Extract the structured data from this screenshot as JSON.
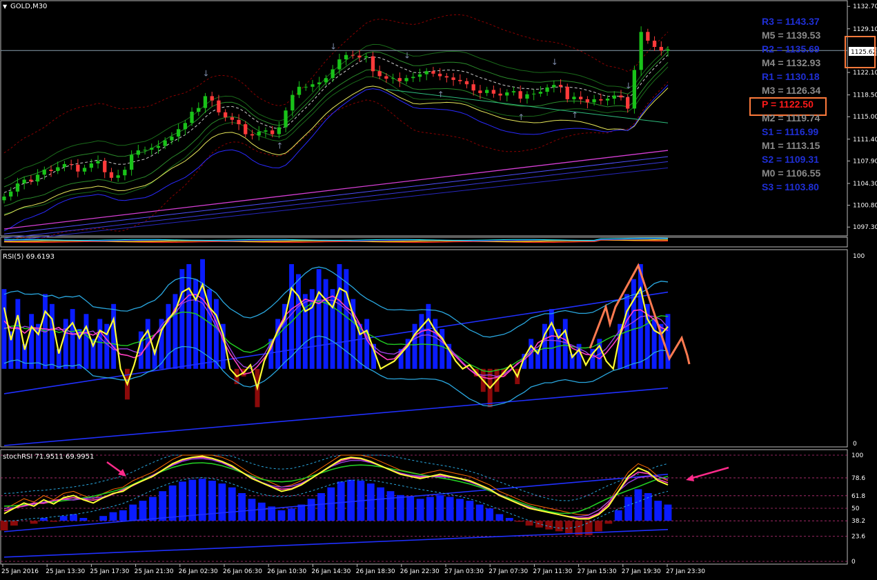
{
  "header": {
    "symbol_label": "GOLD,M30",
    "rsi_label": "RSI(5) 69.6193",
    "stoch_label": "stochRSI 71.9511 69.9951"
  },
  "current_price": "1125.62",
  "colors": {
    "background": "#000000",
    "bull_candle": "#19c219",
    "bear_candle": "#ff3a3a",
    "pivot_blue": "#1f2fd6",
    "pivot_gray": "#8a8a8a",
    "pivot_red": "#ff1a1a",
    "highlight_box": "#ff7a3c",
    "rsi_line": "#ffff33",
    "hist_up": "#0a1cff",
    "hist_down": "#8b0a0a"
  },
  "pivots": [
    {
      "label": "R3 = 1143.37",
      "color": "blue"
    },
    {
      "label": "M5 = 1139.53",
      "color": "gray"
    },
    {
      "label": "R2 = 1135.69",
      "color": "blue"
    },
    {
      "label": "M4 = 1132.93",
      "color": "gray"
    },
    {
      "label": "R1 = 1130.18",
      "color": "blue"
    },
    {
      "label": "M3 = 1126.34",
      "color": "gray"
    },
    {
      "label": "P  = 1122.50",
      "color": "red"
    },
    {
      "label": "M2 = 1119.74",
      "color": "gray"
    },
    {
      "label": "S1 = 1116.99",
      "color": "blue"
    },
    {
      "label": "M1 = 1113.15",
      "color": "gray"
    },
    {
      "label": "S2 = 1109.31",
      "color": "blue"
    },
    {
      "label": "M0 = 1106.55",
      "color": "gray"
    },
    {
      "label": "S3 = 1103.80",
      "color": "blue"
    }
  ],
  "chart_data": [
    {
      "type": "candlestick",
      "title": "GOLD,M30",
      "ylim": [
        1096.0,
        1133.5
      ],
      "yticks": [
        "1132.70",
        "1129.10",
        "1125.62",
        "1122.10",
        "1118.50",
        "1115.00",
        "1111.40",
        "1107.90",
        "1104.30",
        "1100.80",
        "1097.30"
      ],
      "yticks_values": [
        1132.7,
        1129.1,
        1125.62,
        1122.1,
        1118.5,
        1115.0,
        1111.4,
        1107.9,
        1104.3,
        1100.8,
        1097.3
      ],
      "price_path": [
        1102.2,
        1103.0,
        1104.3,
        1104.9,
        1104.6,
        1105.7,
        1106.5,
        1106.3,
        1106.9,
        1107.4,
        1107.3,
        1106.2,
        1106.8,
        1107.5,
        1107.9,
        1106.1,
        1105.2,
        1105.6,
        1106.5,
        1108.9,
        1109.6,
        1109.7,
        1110.0,
        1110.3,
        1111.2,
        1111.8,
        1113.0,
        1114.0,
        1115.8,
        1116.4,
        1118.3,
        1117.6,
        1115.7,
        1114.9,
        1114.5,
        1113.8,
        1112.2,
        1112.0,
        1112.6,
        1112.8,
        1112.2,
        1113.3,
        1116.0,
        1118.5,
        1119.8,
        1119.8,
        1120.2,
        1120.5,
        1121.2,
        1122.6,
        1124.2,
        1124.9,
        1124.8,
        1124.5,
        1124.7,
        1122.3,
        1121.5,
        1121.1,
        1121.2,
        1120.7,
        1121.2,
        1121.4,
        1121.8,
        1122.3,
        1121.9,
        1121.5,
        1121.3,
        1120.9,
        1120.7,
        1120.2,
        1119.2,
        1118.8,
        1119.3,
        1118.7,
        1118.4,
        1118.9,
        1119.1,
        1117.9,
        1118.6,
        1118.7,
        1119.0,
        1119.7,
        1120.1,
        1119.8,
        1117.8,
        1118.2,
        1117.8,
        1117.3,
        1117.8,
        1117.6,
        1117.9,
        1118.4,
        1118.1,
        1116.3,
        1122.5,
        1128.6,
        1127.2,
        1126.2,
        1125.6,
        1125.8
      ]
    },
    {
      "type": "line",
      "title": "RSI(5) 69.6193",
      "ylim": [
        0,
        100
      ],
      "yticks": [
        "100",
        "0"
      ],
      "yticks_values": [
        100,
        0
      ],
      "series": [
        {
          "values": [
            72,
            55,
            68,
            50,
            62,
            58,
            70,
            66,
            48,
            60,
            64,
            56,
            62,
            52,
            60,
            58,
            66,
            40,
            32,
            42,
            55,
            60,
            48,
            60,
            66,
            70,
            80,
            82,
            76,
            84,
            72,
            68,
            58,
            40,
            36,
            38,
            42,
            30,
            44,
            52,
            60,
            66,
            82,
            78,
            70,
            72,
            80,
            76,
            72,
            82,
            80,
            68,
            58,
            60,
            50,
            40,
            42,
            44,
            48,
            52,
            58,
            62,
            66,
            60,
            56,
            50,
            44,
            40,
            42,
            38,
            34,
            30,
            34,
            38,
            42,
            36,
            46,
            52,
            48,
            58,
            64,
            56,
            60,
            46,
            50,
            42,
            48,
            52,
            44,
            40,
            58,
            70,
            76,
            82,
            66,
            60,
            58,
            62
          ]
        }
      ]
    },
    {
      "type": "line",
      "title": "stochRSI 71.9511 69.9951",
      "ylim": [
        0,
        100
      ],
      "yticks": [
        "100",
        "78.6",
        "61.8",
        "50",
        "38.2",
        "23.6",
        "0"
      ],
      "yticks_values": [
        100,
        78.6,
        61.8,
        50,
        38.2,
        23.6,
        0
      ],
      "series": [
        {
          "values": [
            45,
            50,
            55,
            52,
            58,
            54,
            60,
            62,
            58,
            55,
            60,
            64,
            66,
            72,
            76,
            80,
            86,
            92,
            96,
            98,
            99,
            97,
            94,
            90,
            84,
            78,
            74,
            70,
            66,
            68,
            72,
            78,
            84,
            90,
            96,
            98,
            97,
            94,
            90,
            86,
            82,
            80,
            78,
            80,
            82,
            80,
            78,
            76,
            72,
            68,
            62,
            58,
            54,
            50,
            48,
            46,
            44,
            42,
            40,
            40,
            44,
            52,
            66,
            80,
            88,
            84,
            76,
            72
          ]
        }
      ]
    }
  ],
  "xaxis": {
    "labels": [
      "25 Jan 2016",
      "25 Jan 13:30",
      "25 Jan 17:30",
      "25 Jan 21:30",
      "26 Jan 02:30",
      "26 Jan 06:30",
      "26 Jan 10:30",
      "26 Jan 14:30",
      "26 Jan 18:30",
      "26 Jan 22:30",
      "27 Jan 03:30",
      "27 Jan 07:30",
      "27 Jan 11:30",
      "27 Jan 15:30",
      "27 Jan 19:30",
      "27 Jan 23:30"
    ]
  }
}
